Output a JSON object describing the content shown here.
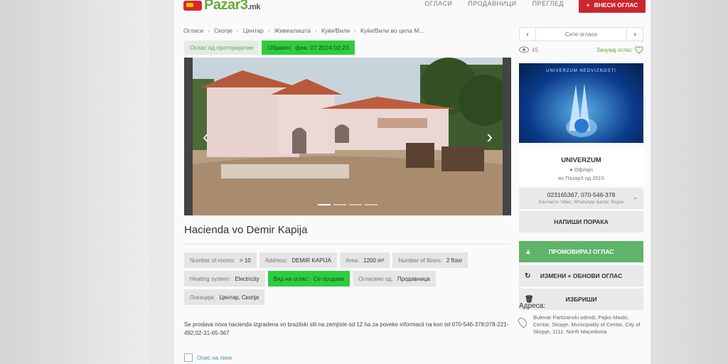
{
  "header": {
    "logo_text": "Pazar3",
    "logo_suffix": ".mk",
    "nav": [
      "ОГЛАСИ",
      "ПРОДАВНИЦИ",
      "ПРЕГЛЕД"
    ],
    "add_button": "ВНЕСИ ОГЛАС",
    "add_icon": "+"
  },
  "breadcrumb": [
    "Огласи",
    "Скопје",
    "Центар",
    "Живеалишта",
    "Куќи/Вили",
    "Куќи/Вили во цела М..."
  ],
  "tags": {
    "seller_type": "Оглас од претпријатие",
    "published_label": "Објавен:",
    "published_value": "фев. 07 2024  02:23"
  },
  "gallery": {
    "prev": "‹",
    "next": "›",
    "slide_count": 4,
    "active_slide": 1
  },
  "listing": {
    "title": "Hacienda vo Demir Kapija",
    "attributes": [
      {
        "key": "Number of rooms:",
        "value": "> 10"
      },
      {
        "key": "Address:",
        "value": "DEMIR KAPIJA"
      },
      {
        "key": "Area:",
        "value": "1200 m²"
      },
      {
        "key": "Number of floors:",
        "value": "2 floor"
      },
      {
        "key": "Heating system:",
        "value": "Electricity"
      },
      {
        "key": "Вид на оглас:",
        "value": "Се продава"
      },
      {
        "key": "Огласено од:",
        "value": "Продавница"
      },
      {
        "key": "Локација:",
        "value": "Центар, Скопје"
      }
    ],
    "description": "Se prodava nova hacienda izgradena vo brazilski stil na zemjiste od 12 ha za poveke informacii na kon tel 070-546-378;078-221-492;02-31-65-367",
    "map_link": "Опис на линк"
  },
  "sidebar": {
    "pager": {
      "prev": "‹",
      "label": "Сите огласи",
      "next": "›"
    },
    "views": "45",
    "save_label": "Зачувај оглас",
    "banner_text": "UNIVERZUM NEDVIZNOSTI",
    "seller": {
      "name": "UNIVERZUM",
      "status": "● Офлајн",
      "since": "во Пазар3 од 2015"
    },
    "phone": {
      "numbers": "023165367, 070-546-378",
      "contacts": "Контакти: Viber, WhatsApp &amp; Skype"
    },
    "buttons": {
      "message": "НАПИШИ ПОРАКА",
      "promote": "ПРОМОВИРАЈ ОГЛАС",
      "edit": "ИЗМЕНИ + ОБНОВИ ОГЛАС",
      "delete": "ИЗБРИШИ"
    },
    "address": {
      "label": "Адреса:",
      "text": "Bulevar Partizanski odredi, Pajko Maalo, Centar, Skopje, Municipality of Centar, City of Skopje, 1111, North Macedonia"
    }
  },
  "colors": {
    "brand_green": "#6aaa3a",
    "add_red": "#c9272d",
    "highlight_green": "#2ecc40",
    "promo_green": "#5fb46a"
  }
}
